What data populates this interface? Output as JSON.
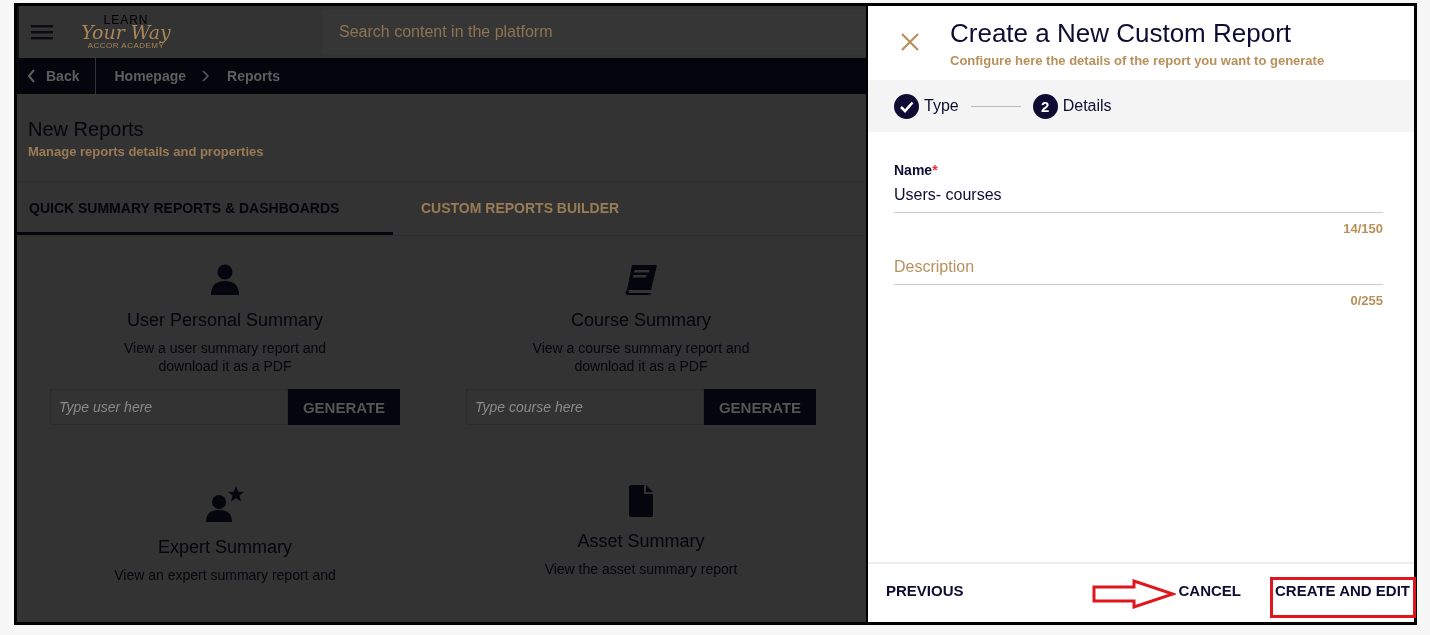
{
  "header": {
    "logo": {
      "top": "LEARN",
      "script": "Your Way",
      "bottom": "ACCOR ACADEMY"
    },
    "search": {
      "placeholder": "Search content in the platform"
    }
  },
  "breadcrumb": {
    "back": "Back",
    "items": [
      "Homepage",
      "Reports"
    ]
  },
  "page": {
    "title": "New Reports",
    "subtitle": "Manage reports details and properties"
  },
  "tabs": [
    {
      "label": "QUICK SUMMARY REPORTS & DASHBOARDS",
      "selected": true
    },
    {
      "label": "CUSTOM REPORTS BUILDER",
      "selected": false
    }
  ],
  "cards": [
    {
      "kind": "user",
      "title": "User Personal Summary",
      "description": "View a user summary report and download it as a PDF",
      "input": {
        "placeholder": "Type user here"
      },
      "button": "GENERATE"
    },
    {
      "kind": "book",
      "title": "Course Summary",
      "description": "View a course summary report and download it as a PDF",
      "input": {
        "placeholder": "Type course here"
      },
      "button": "GENERATE"
    },
    {
      "kind": "expert",
      "title": "Expert Summary",
      "description": "View an expert summary report and"
    },
    {
      "kind": "asset",
      "title": "Asset Summary",
      "description": "View the asset summary report"
    }
  ],
  "drawer": {
    "title": "Create a New Custom Report",
    "subtitle": "Configure here the details of the report you want to generate",
    "steps": [
      {
        "label": "Type",
        "done": true
      },
      {
        "number": "2",
        "label": "Details",
        "done": false
      }
    ],
    "fields": [
      {
        "label": "Name",
        "required_mark": "*",
        "value": "Users- courses",
        "counter": "14/150"
      },
      {
        "placeholder": "Description",
        "counter": "0/255"
      }
    ],
    "footer": {
      "previous": "PREVIOUS",
      "cancel": "CANCEL",
      "create": "CREATE AND EDIT"
    }
  }
}
